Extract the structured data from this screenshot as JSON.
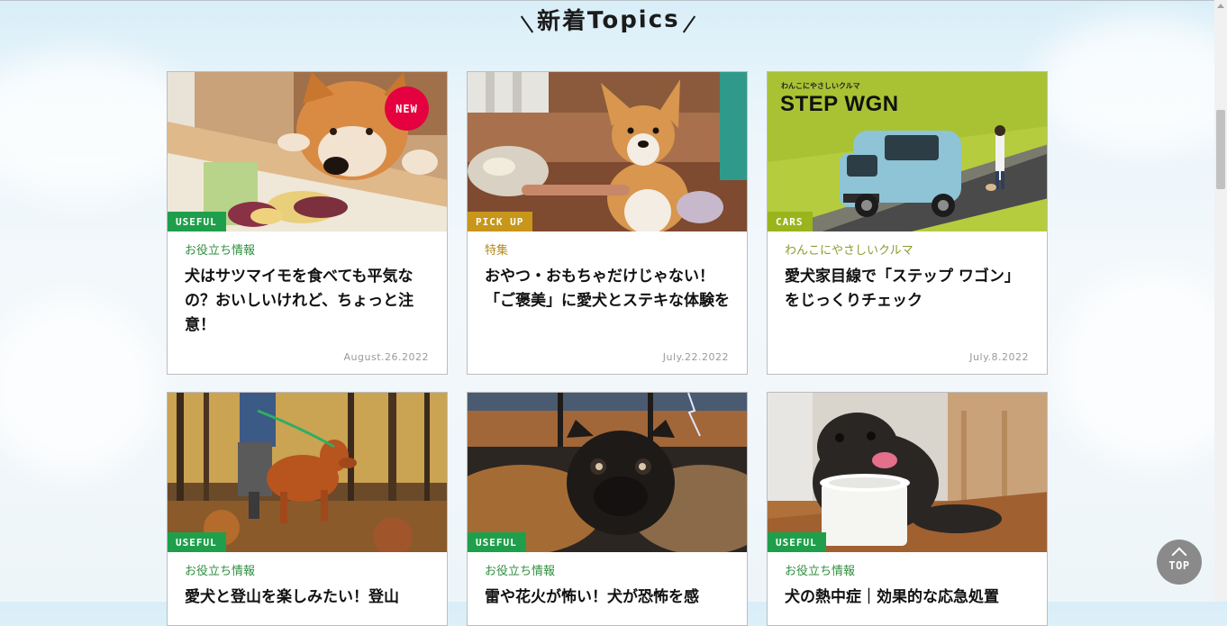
{
  "section_title": "新着Topics",
  "colors": {
    "useful": "#1f9f4b",
    "pickup": "#c7961a",
    "cars": "#9ab51c",
    "new": "#e5003f"
  },
  "cards": [
    {
      "badge": "USEFUL",
      "badge_color": "#1f9f4b",
      "new_label": "NEW",
      "category": "お役立ち情報",
      "category_color": "#2f8f3f",
      "title": "犬はサツマイモを食べても平気なの？おいしいけれど、ちょっと注意！",
      "date": "August.26.2022"
    },
    {
      "badge": "PICK UP",
      "badge_color": "#c7961a",
      "category": "特集",
      "category_color": "#b58a22",
      "title": "おやつ・おもちゃだけじゃない！「ご褒美」に愛犬とステキな体験を",
      "date": "July.22.2022"
    },
    {
      "badge": "CARS",
      "badge_color": "#9ab51c",
      "category": "わんこにやさしいクルマ",
      "category_color": "#8a9d2e",
      "title": "愛犬家目線で「ステップ ワゴン」をじっくりチェック",
      "date": "July.8.2022",
      "image_text_small": "わんこにやさしいクルマ",
      "image_text_big": "STEP WGN"
    },
    {
      "badge": "USEFUL",
      "badge_color": "#1f9f4b",
      "category": "お役立ち情報",
      "category_color": "#2f8f3f",
      "title": "愛犬と登山を楽しみたい！登山"
    },
    {
      "badge": "USEFUL",
      "badge_color": "#1f9f4b",
      "category": "お役立ち情報",
      "category_color": "#2f8f3f",
      "title": "雷や花火が怖い！犬が恐怖を感"
    },
    {
      "badge": "USEFUL",
      "badge_color": "#1f9f4b",
      "category": "お役立ち情報",
      "category_color": "#2f8f3f",
      "title": "犬の熱中症｜効果的な応急処置"
    }
  ],
  "top_button": {
    "label": "TOP"
  }
}
